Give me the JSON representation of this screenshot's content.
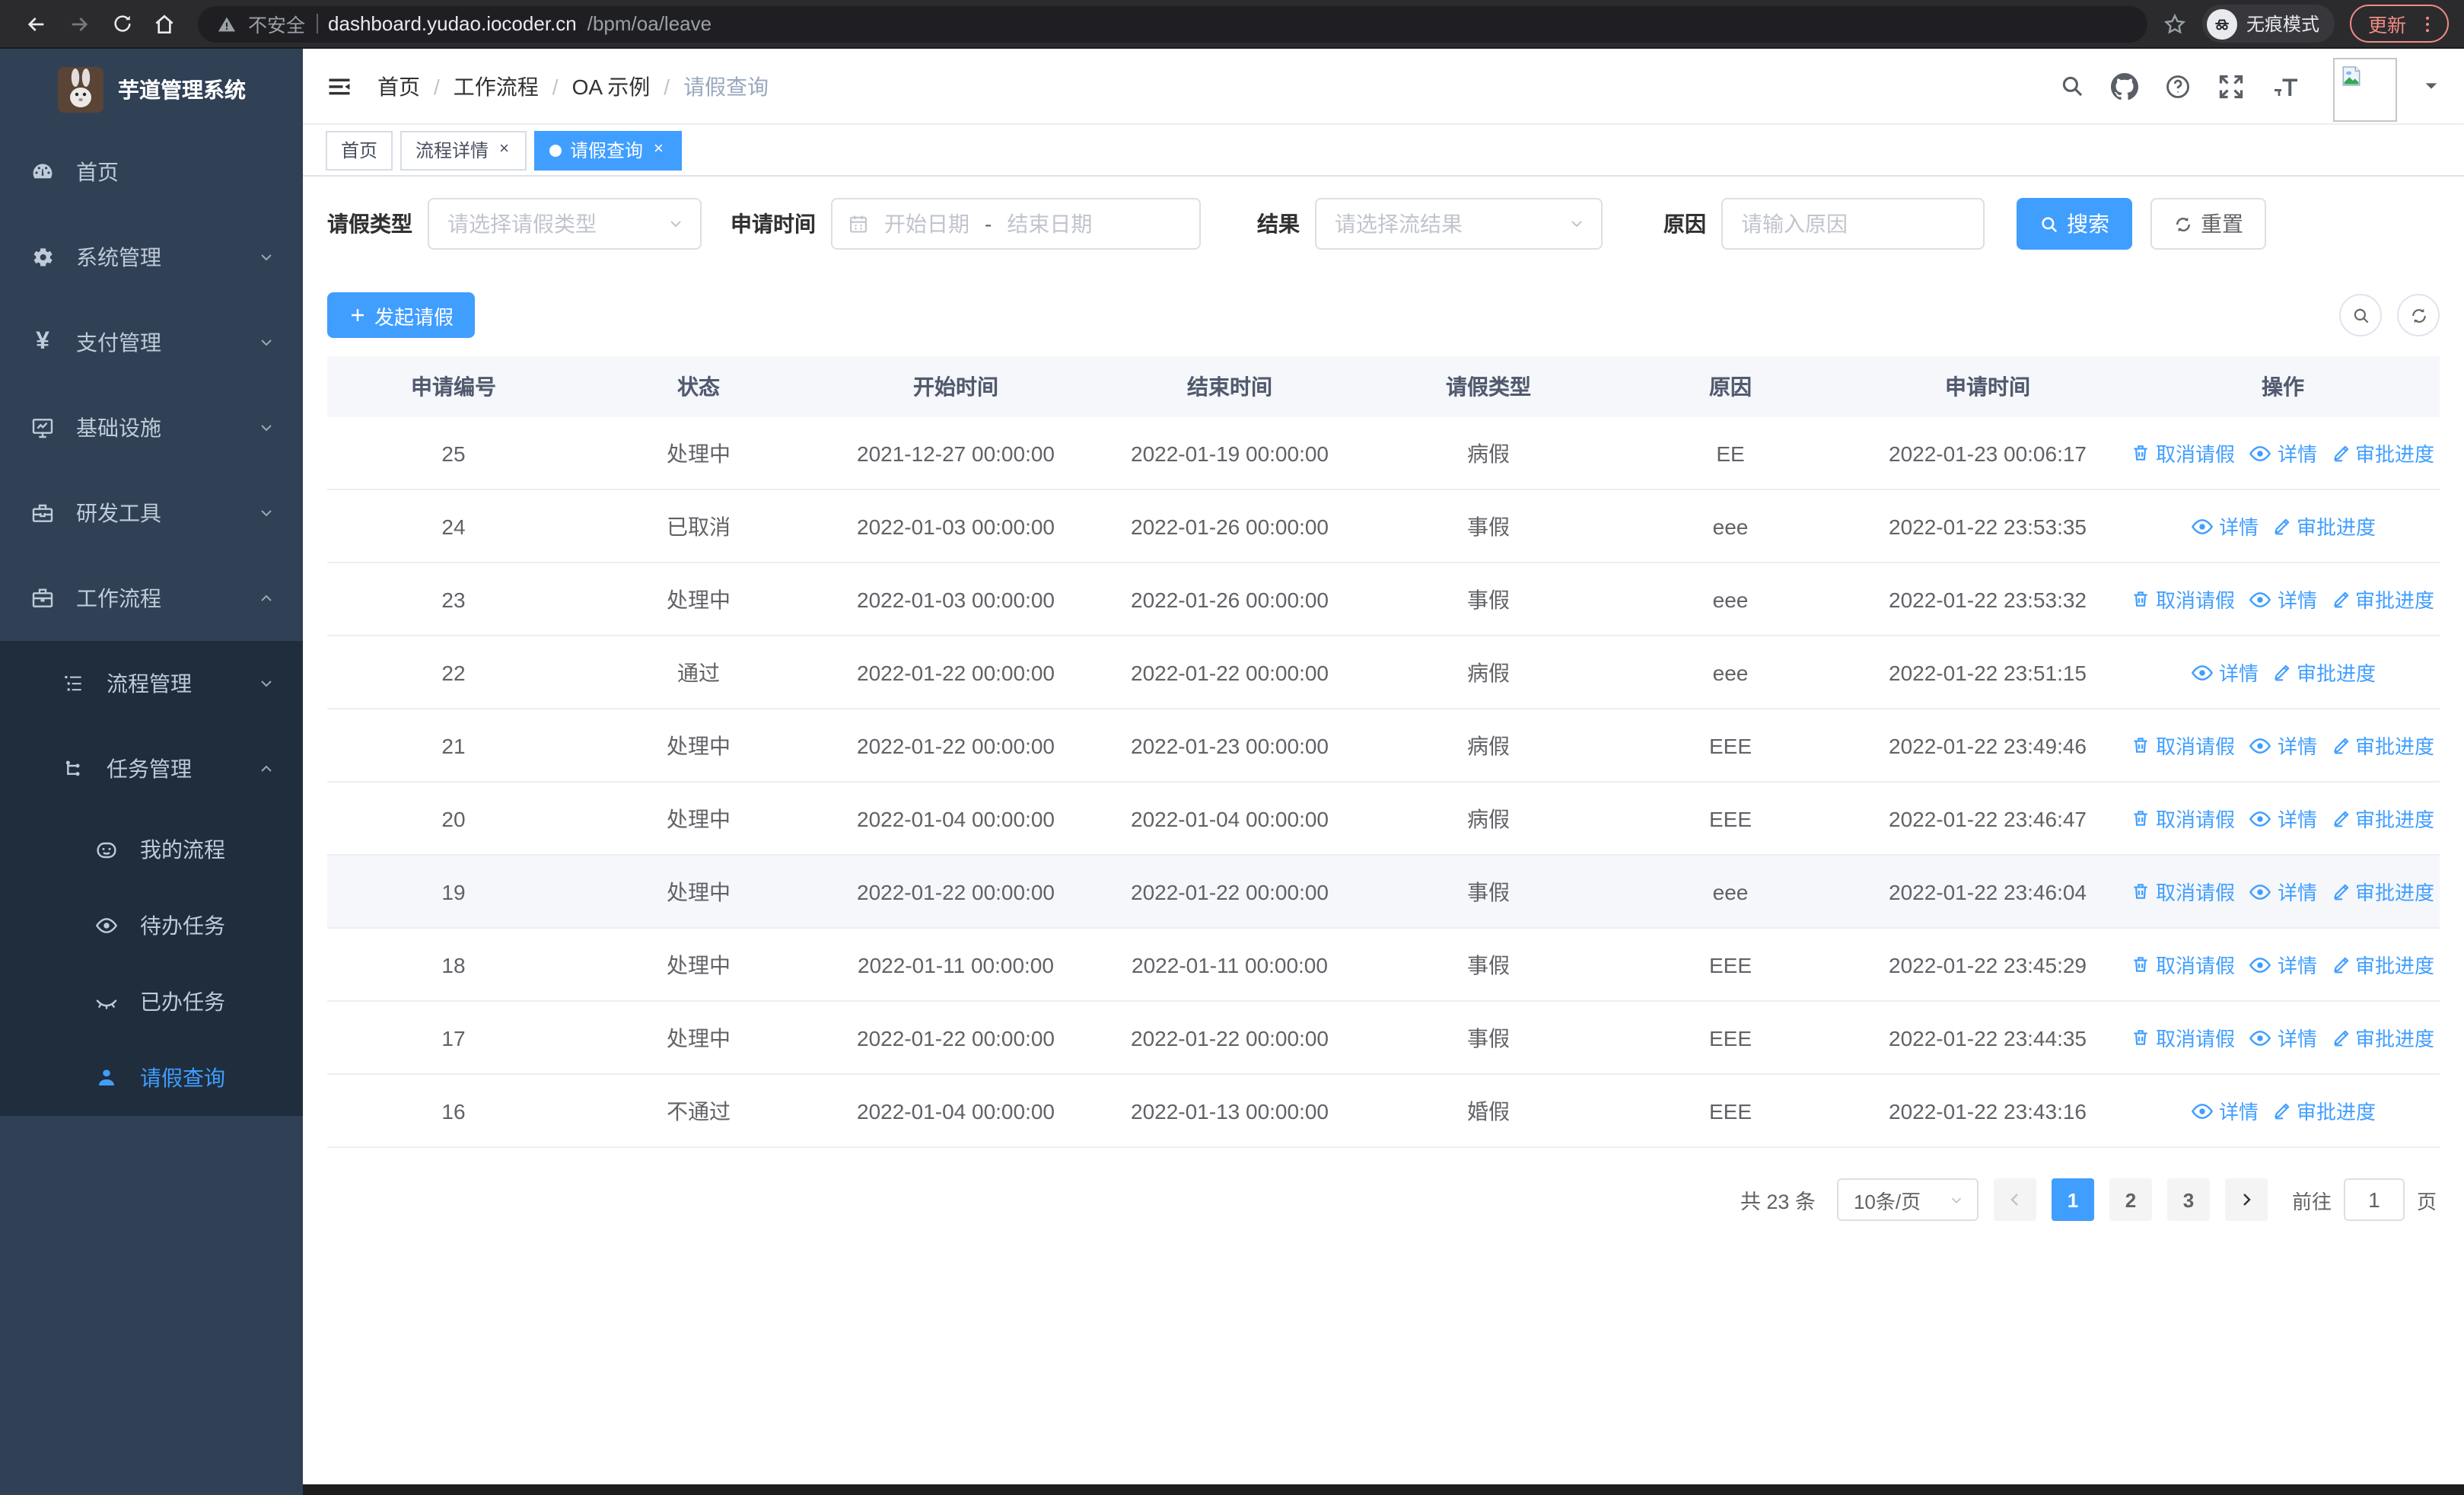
{
  "browser": {
    "security_warning": "不安全",
    "url_host": "dashboard.yudao.iocoder.cn",
    "url_path": "/bpm/oa/leave",
    "incognito_label": "无痕模式",
    "update_label": "更新"
  },
  "sidebar": {
    "title": "芋道管理系统",
    "items": [
      {
        "label": "首页",
        "icon": "dashboard-icon",
        "depth": 0,
        "sub": false,
        "chevron": "",
        "active": false
      },
      {
        "label": "系统管理",
        "icon": "gear-icon",
        "depth": 0,
        "sub": false,
        "chevron": "down",
        "active": false
      },
      {
        "label": "支付管理",
        "icon": "yen-icon",
        "depth": 0,
        "sub": false,
        "chevron": "down",
        "active": false
      },
      {
        "label": "基础设施",
        "icon": "monitor-icon",
        "depth": 0,
        "sub": false,
        "chevron": "down",
        "active": false
      },
      {
        "label": "研发工具",
        "icon": "toolbox-icon",
        "depth": 0,
        "sub": false,
        "chevron": "down",
        "active": false
      },
      {
        "label": "工作流程",
        "icon": "briefcase-icon",
        "depth": 0,
        "sub": false,
        "chevron": "up",
        "active": false
      },
      {
        "label": "流程管理",
        "icon": "tree-list-icon",
        "depth": 1,
        "sub": true,
        "chevron": "down",
        "active": false
      },
      {
        "label": "任务管理",
        "icon": "flow-icon",
        "depth": 1,
        "sub": true,
        "chevron": "up",
        "active": false
      },
      {
        "label": "我的流程",
        "icon": "face-icon",
        "depth": 2,
        "sub": true,
        "chevron": "",
        "active": false
      },
      {
        "label": "待办任务",
        "icon": "eye-icon",
        "depth": 2,
        "sub": true,
        "chevron": "",
        "active": false
      },
      {
        "label": "已办任务",
        "icon": "eye-closed-icon",
        "depth": 2,
        "sub": true,
        "chevron": "",
        "active": false
      },
      {
        "label": "请假查询",
        "icon": "person-icon",
        "depth": 2,
        "sub": true,
        "chevron": "",
        "active": true
      }
    ]
  },
  "breadcrumb": [
    "首页",
    "工作流程",
    "OA 示例",
    "请假查询"
  ],
  "tabs": [
    {
      "label": "首页",
      "closable": false,
      "active": false
    },
    {
      "label": "流程详情",
      "closable": true,
      "active": false
    },
    {
      "label": "请假查询",
      "closable": true,
      "active": true
    }
  ],
  "filters": {
    "leave_type_label": "请假类型",
    "leave_type_placeholder": "请选择请假类型",
    "apply_time_label": "申请时间",
    "date_start_placeholder": "开始日期",
    "date_separator": "-",
    "date_end_placeholder": "结束日期",
    "result_label": "结果",
    "result_placeholder": "请选择流结果",
    "reason_label": "原因",
    "reason_placeholder": "请输入原因",
    "search_label": "搜索",
    "reset_label": "重置"
  },
  "toolbar": {
    "create_label": "发起请假"
  },
  "table": {
    "columns": [
      "申请编号",
      "状态",
      "开始时间",
      "结束时间",
      "请假类型",
      "原因",
      "申请时间",
      "操作"
    ],
    "action_labels": {
      "cancel": "取消请假",
      "detail": "详情",
      "progress": "审批进度"
    },
    "rows": [
      {
        "id": "25",
        "status": "处理中",
        "start": "2021-12-27 00:00:00",
        "end": "2022-01-19 00:00:00",
        "type": "病假",
        "reason": "EE",
        "applied": "2022-01-23 00:06:17",
        "actions": [
          "cancel",
          "detail",
          "progress"
        ],
        "highlight": false
      },
      {
        "id": "24",
        "status": "已取消",
        "start": "2022-01-03 00:00:00",
        "end": "2022-01-26 00:00:00",
        "type": "事假",
        "reason": "eee",
        "applied": "2022-01-22 23:53:35",
        "actions": [
          "detail",
          "progress"
        ],
        "highlight": false
      },
      {
        "id": "23",
        "status": "处理中",
        "start": "2022-01-03 00:00:00",
        "end": "2022-01-26 00:00:00",
        "type": "事假",
        "reason": "eee",
        "applied": "2022-01-22 23:53:32",
        "actions": [
          "cancel",
          "detail",
          "progress"
        ],
        "highlight": false
      },
      {
        "id": "22",
        "status": "通过",
        "start": "2022-01-22 00:00:00",
        "end": "2022-01-22 00:00:00",
        "type": "病假",
        "reason": "eee",
        "applied": "2022-01-22 23:51:15",
        "actions": [
          "detail",
          "progress"
        ],
        "highlight": false
      },
      {
        "id": "21",
        "status": "处理中",
        "start": "2022-01-22 00:00:00",
        "end": "2022-01-23 00:00:00",
        "type": "病假",
        "reason": "EEE",
        "applied": "2022-01-22 23:49:46",
        "actions": [
          "cancel",
          "detail",
          "progress"
        ],
        "highlight": false
      },
      {
        "id": "20",
        "status": "处理中",
        "start": "2022-01-04 00:00:00",
        "end": "2022-01-04 00:00:00",
        "type": "病假",
        "reason": "EEE",
        "applied": "2022-01-22 23:46:47",
        "actions": [
          "cancel",
          "detail",
          "progress"
        ],
        "highlight": false
      },
      {
        "id": "19",
        "status": "处理中",
        "start": "2022-01-22 00:00:00",
        "end": "2022-01-22 00:00:00",
        "type": "事假",
        "reason": "eee",
        "applied": "2022-01-22 23:46:04",
        "actions": [
          "cancel",
          "detail",
          "progress"
        ],
        "highlight": true
      },
      {
        "id": "18",
        "status": "处理中",
        "start": "2022-01-11 00:00:00",
        "end": "2022-01-11 00:00:00",
        "type": "事假",
        "reason": "EEE",
        "applied": "2022-01-22 23:45:29",
        "actions": [
          "cancel",
          "detail",
          "progress"
        ],
        "highlight": false
      },
      {
        "id": "17",
        "status": "处理中",
        "start": "2022-01-22 00:00:00",
        "end": "2022-01-22 00:00:00",
        "type": "事假",
        "reason": "EEE",
        "applied": "2022-01-22 23:44:35",
        "actions": [
          "cancel",
          "detail",
          "progress"
        ],
        "highlight": false
      },
      {
        "id": "16",
        "status": "不通过",
        "start": "2022-01-04 00:00:00",
        "end": "2022-01-13 00:00:00",
        "type": "婚假",
        "reason": "EEE",
        "applied": "2022-01-22 23:43:16",
        "actions": [
          "detail",
          "progress"
        ],
        "highlight": false
      }
    ]
  },
  "pagination": {
    "total_text": "共 23 条",
    "page_size": "10条/页",
    "pages": [
      "1",
      "2",
      "3"
    ],
    "active_page": "1",
    "goto_label": "前往",
    "goto_value": "1",
    "goto_suffix": "页"
  },
  "colors": {
    "accent": "#409eff",
    "sidebar_bg": "#304156",
    "submenu_bg": "#1f2d3d",
    "update_pill": "#f28b82"
  }
}
